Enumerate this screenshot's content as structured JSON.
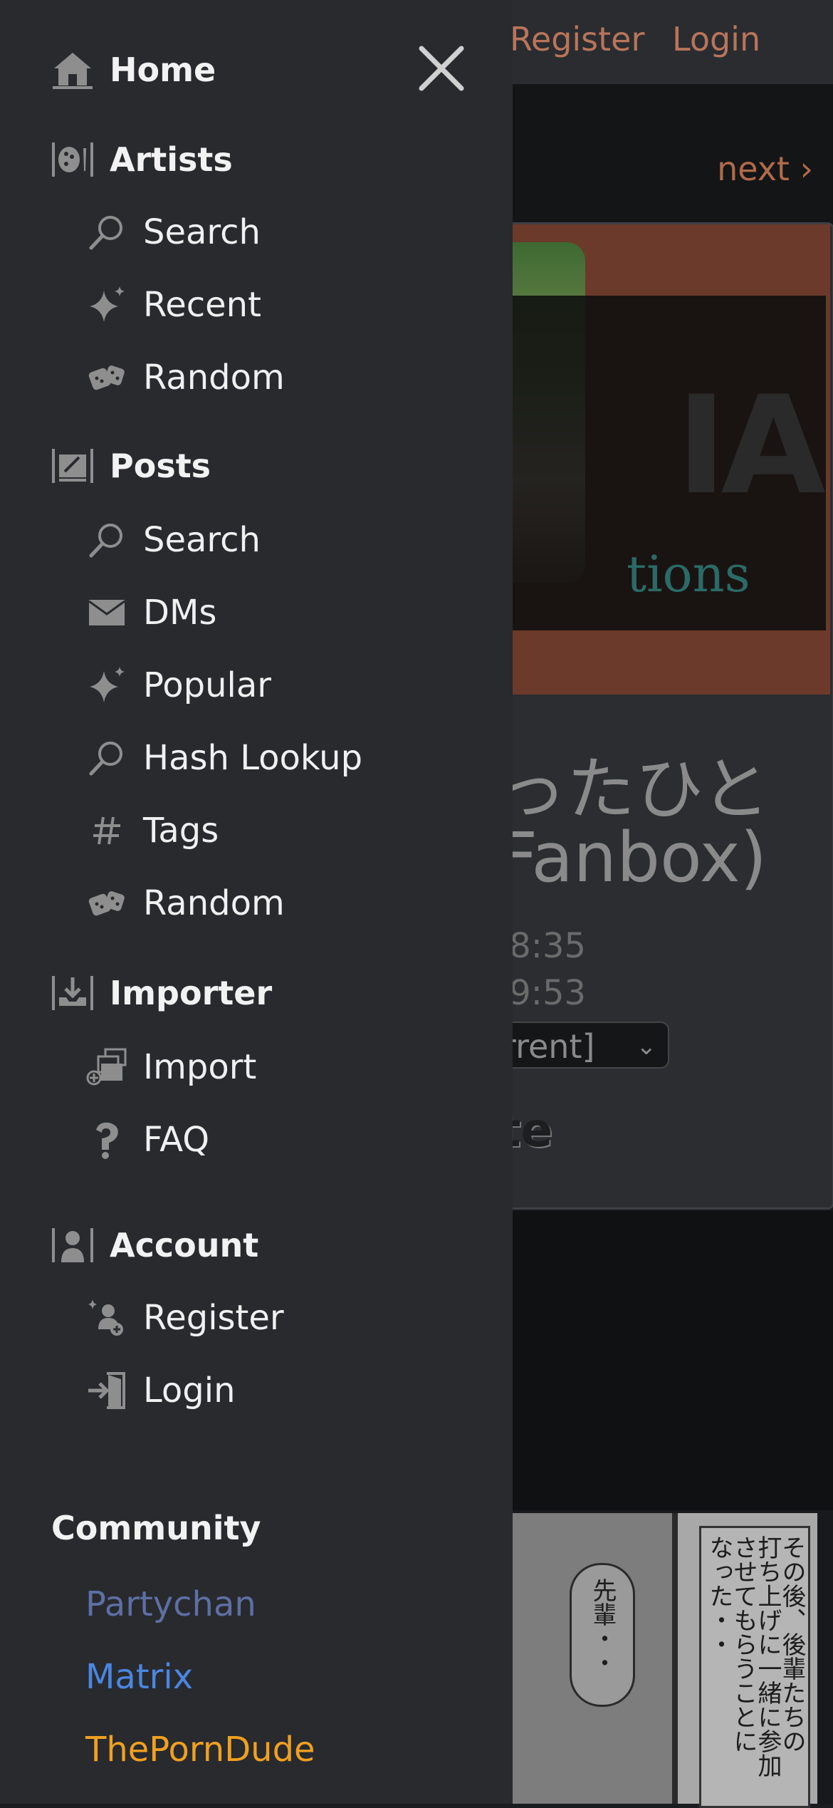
{
  "header": {
    "register_label": "Register",
    "login_label": "Login"
  },
  "background_page": {
    "next_label": "next ›",
    "title_line1": "ったひと",
    "title_line2": "Fanbox)",
    "time1": ".8:35",
    "time2": ".9:53",
    "revision_select": "rrent]",
    "label_te": "te",
    "banner_text_large": "IA",
    "banner_text_small": "tions",
    "manga_bubble": "先輩・・",
    "manga_text_col1": "その後、後輩たちの",
    "manga_text_col2": "打ち上げに一緒に参加",
    "manga_text_col3": "させてもらうことに",
    "manga_text_col4": "なった・・"
  },
  "sidebar": {
    "home": "Home",
    "artists": {
      "label": "Artists",
      "items": [
        {
          "label": "Search",
          "icon": "search-icon"
        },
        {
          "label": "Recent",
          "icon": "sparkle-icon"
        },
        {
          "label": "Random",
          "icon": "dice-icon"
        }
      ]
    },
    "posts": {
      "label": "Posts",
      "items": [
        {
          "label": "Search",
          "icon": "search-icon"
        },
        {
          "label": "DMs",
          "icon": "envelope-icon"
        },
        {
          "label": "Popular",
          "icon": "sparkle-icon"
        },
        {
          "label": "Hash Lookup",
          "icon": "search-icon"
        },
        {
          "label": "Tags",
          "icon": "hash-icon"
        },
        {
          "label": "Random",
          "icon": "dice-icon"
        }
      ]
    },
    "importer": {
      "label": "Importer",
      "items": [
        {
          "label": "Import",
          "icon": "import-icon"
        },
        {
          "label": "FAQ",
          "icon": "question-icon"
        }
      ]
    },
    "account": {
      "label": "Account",
      "items": [
        {
          "label": "Register",
          "icon": "add-user-icon"
        },
        {
          "label": "Login",
          "icon": "login-icon"
        }
      ]
    },
    "community": {
      "label": "Community",
      "links": [
        {
          "label": "Partychan",
          "color": "#5d6fa3"
        },
        {
          "label": "Matrix",
          "color": "#4a86e0"
        },
        {
          "label": "ThePornDude",
          "color": "#f0a020"
        }
      ]
    }
  },
  "colors": {
    "sidebar_bg": "#282a2e",
    "icon_gray": "#8e8e8e",
    "accent_orange": "#b8755a"
  }
}
